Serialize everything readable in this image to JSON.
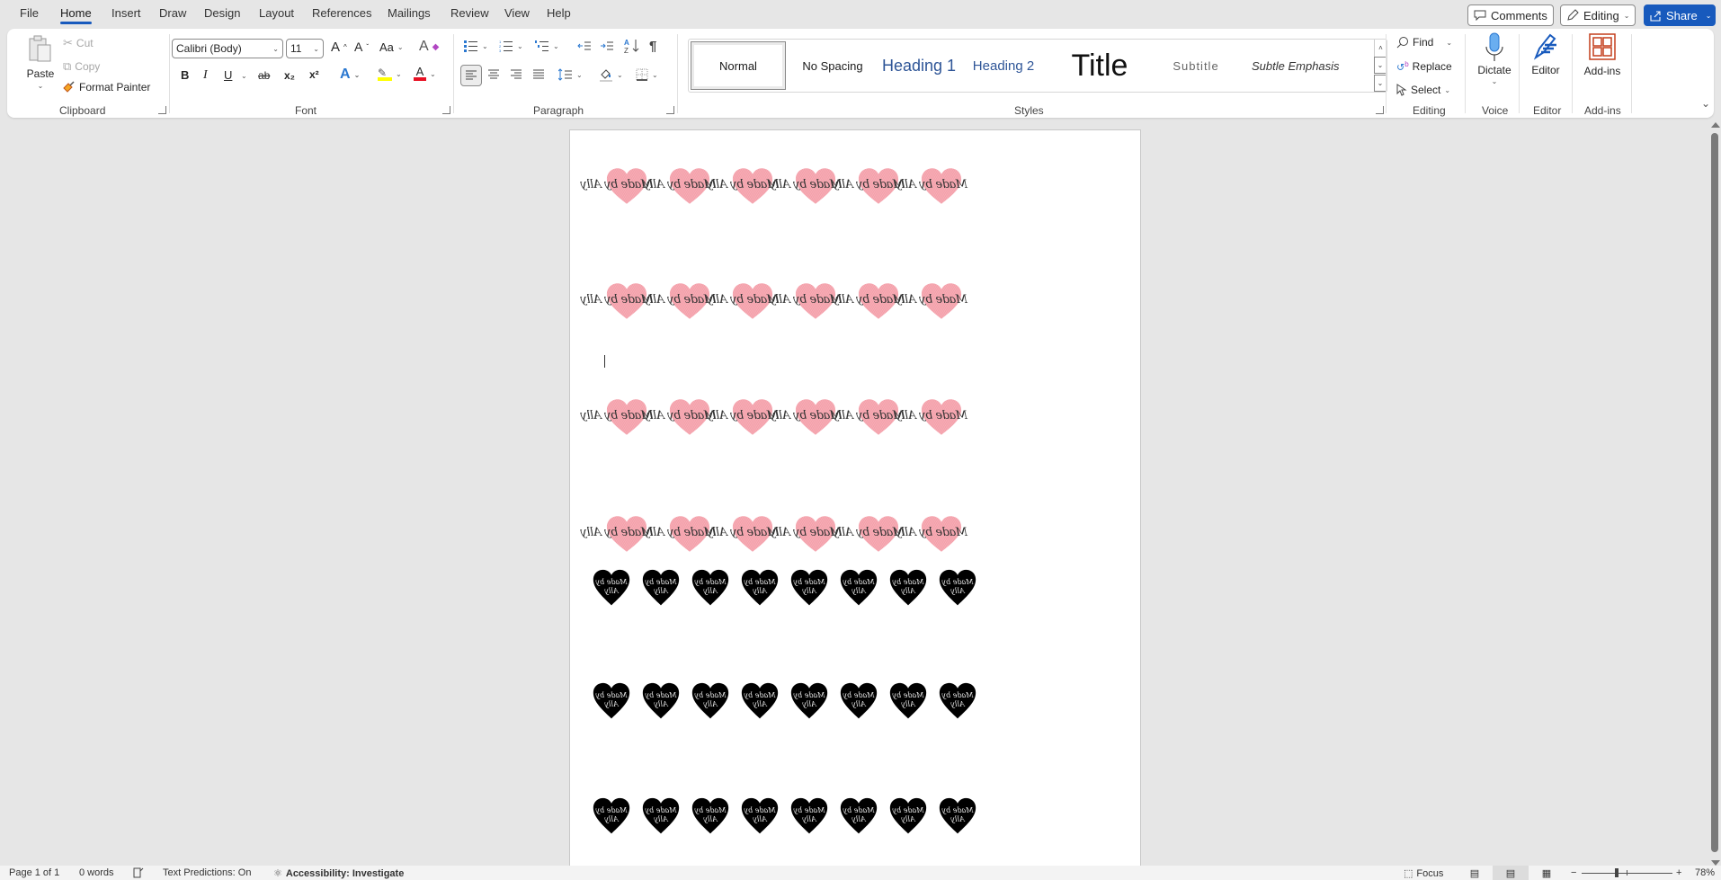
{
  "tabs": [
    {
      "label": "File",
      "active": false
    },
    {
      "label": "Home",
      "active": true
    },
    {
      "label": "Insert",
      "active": false
    },
    {
      "label": "Draw",
      "active": false
    },
    {
      "label": "Design",
      "active": false
    },
    {
      "label": "Layout",
      "active": false
    },
    {
      "label": "References",
      "active": false
    },
    {
      "label": "Mailings",
      "active": false
    },
    {
      "label": "Review",
      "active": false
    },
    {
      "label": "View",
      "active": false
    },
    {
      "label": "Help",
      "active": false
    }
  ],
  "top_actions": {
    "comments": "Comments",
    "editing": "Editing",
    "share": "Share"
  },
  "ribbon": {
    "clipboard": {
      "label": "Clipboard",
      "paste": "Paste",
      "cut": "Cut",
      "copy": "Copy",
      "format_painter": "Format Painter"
    },
    "font": {
      "label": "Font",
      "font_name": "Calibri (Body)",
      "font_size": "11",
      "bold": "B",
      "italic": "I",
      "underline": "U",
      "strikethrough": "ab",
      "subscript": "x₂",
      "superscript": "x²",
      "change_case": "Aa",
      "highlight_color": "#ffff00",
      "font_color": "#e81123"
    },
    "paragraph": {
      "label": "Paragraph"
    },
    "styles": {
      "label": "Styles",
      "items": [
        {
          "label": "Normal",
          "selected": true
        },
        {
          "label": "No Spacing",
          "selected": false
        },
        {
          "label": "Heading 1",
          "selected": false
        },
        {
          "label": "Heading 2",
          "selected": false
        },
        {
          "label": "Title",
          "selected": false
        },
        {
          "label": "Subtitle",
          "selected": false
        },
        {
          "label": "Subtle Emphasis",
          "selected": false
        }
      ]
    },
    "editing": {
      "label": "Editing",
      "find": "Find",
      "replace": "Replace",
      "select": "Select"
    },
    "voice": {
      "label": "Voice",
      "dictate": "Dictate"
    },
    "editor": {
      "label": "Editor",
      "editor": "Editor"
    },
    "addins": {
      "label": "Add-ins",
      "addins": "Add-ins"
    }
  },
  "document": {
    "label_text": "Made by Ally",
    "label_text_line1": "Made by",
    "label_text_line2": "Ally",
    "pink_rows": 4,
    "pink_per_row": 6,
    "black_rows": 3,
    "black_per_row": 8,
    "pink_color": "#f4a0aa",
    "black_color": "#000000"
  },
  "status": {
    "page": "Page 1 of 1",
    "words": "0 words",
    "text_predictions": "Text Predictions: On",
    "accessibility": "Accessibility: Investigate",
    "focus": "Focus",
    "zoom": "78%",
    "zoom_value_percent": 78
  }
}
